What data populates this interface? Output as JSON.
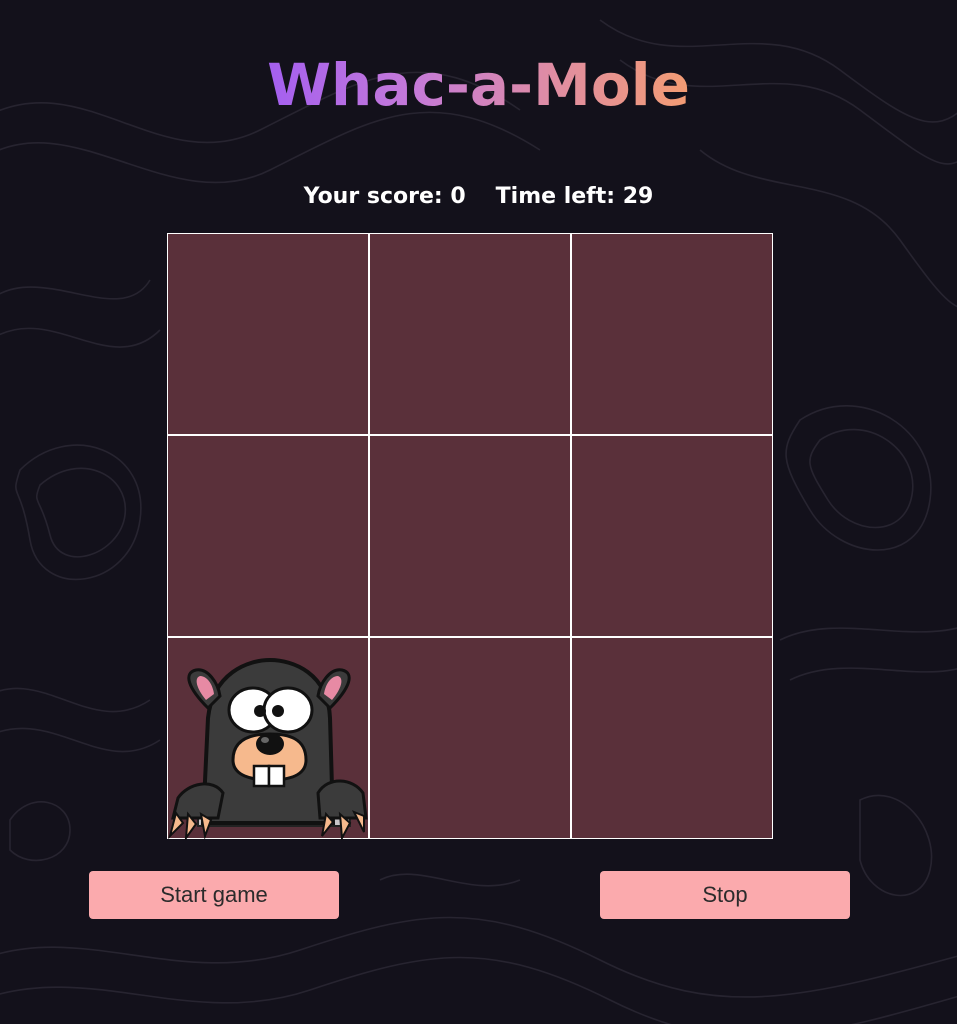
{
  "title": "Whac-a-Mole",
  "score": {
    "score_text": "Your score: 0",
    "time_text": "Time left: 29"
  },
  "board": {
    "rows": 3,
    "cols": 3,
    "mole_cell_index": 6
  },
  "buttons": {
    "start_label": "Start game",
    "stop_label": "Stop"
  },
  "colors": {
    "background": "#13111b",
    "cell": "#5c3b43",
    "button": "#fbaaad",
    "title_gradient_start": "#a45ff0",
    "title_gradient_end": "#f39c73"
  }
}
